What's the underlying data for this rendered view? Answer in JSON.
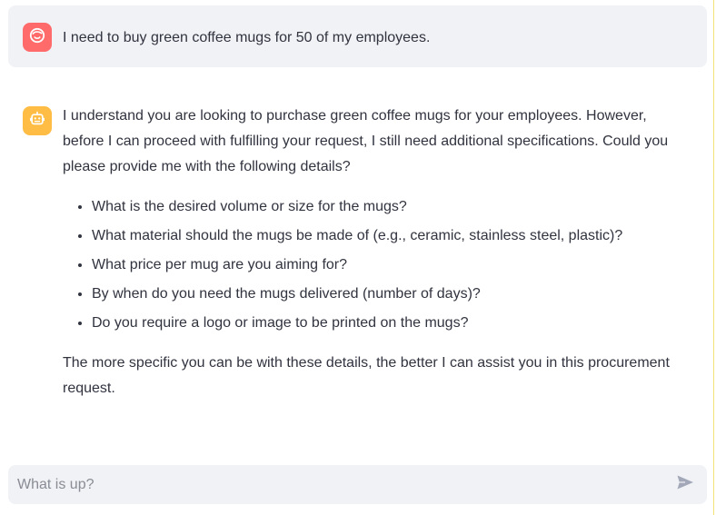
{
  "colors": {
    "user_avatar_bg": "#ff6b6b",
    "bot_avatar_bg": "#ffbd45",
    "message_bg": "#f0f2f6",
    "text": "#31333f"
  },
  "messages": {
    "user": {
      "avatar_icon": "user-face-icon",
      "text": "I need to buy green coffee mugs for 50 of my employees."
    },
    "assistant": {
      "avatar_icon": "robot-face-icon",
      "intro": "I understand you are looking to purchase green coffee mugs for your employees. However, before I can proceed with fulfilling your request, I still need additional specifications. Could you please provide me with the following details?",
      "questions": [
        "What is the desired volume or size for the mugs?",
        "What material should the mugs be made of (e.g., ceramic, stainless steel, plastic)?",
        "What price per mug are you aiming for?",
        "By when do you need the mugs delivered (number of days)?",
        "Do you require a logo or image to be printed on the mugs?"
      ],
      "outro": "The more specific you can be with these details, the better I can assist you in this procurement request."
    }
  },
  "chat_input": {
    "placeholder": "What is up?",
    "send_icon": "send-icon"
  }
}
